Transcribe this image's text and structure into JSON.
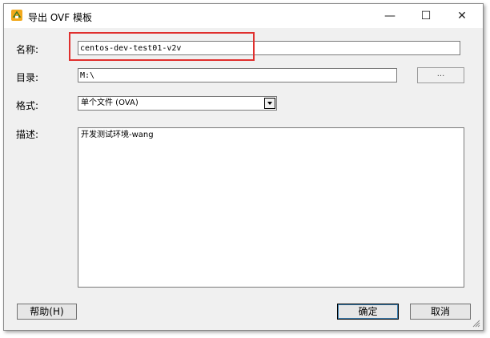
{
  "window": {
    "title": "导出 OVF 模板",
    "controls": {
      "minimize": "—",
      "maximize": "☐",
      "close": "✕"
    }
  },
  "form": {
    "name_label": "名称:",
    "name_value": "centos-dev-test01-v2v",
    "directory_label": "目录:",
    "directory_value": "M:\\",
    "browse_label": "...",
    "format_label": "格式:",
    "format_value": "单个文件 (OVA)",
    "description_label": "描述:",
    "description_value": "开发测试环境-wang"
  },
  "buttons": {
    "help": "帮助(H)",
    "ok": "确定",
    "cancel": "取消"
  },
  "colors": {
    "highlight": "#e0302e",
    "icon": "#f2a91c"
  }
}
